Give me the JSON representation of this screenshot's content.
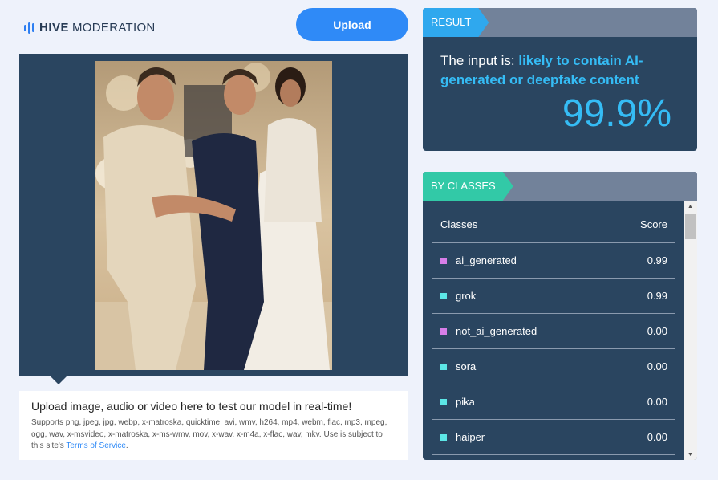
{
  "header": {
    "logo_brand": "HIVE",
    "logo_product": "MODERATION",
    "upload_label": "Upload"
  },
  "upload_panel": {
    "title": "Upload image, audio or video here to test our model in real-time!",
    "description": "Supports png, jpeg, jpg, webp, x-matroska, quicktime, avi, wmv, h264, mp4, webm, flac, mp3, mpeg, ogg, wav, x-msvideo, x-matroska, x-ms-wmv, mov, x-wav, x-m4a, x-flac, wav, mkv. Use is subject to this site's",
    "tos_link": "Terms of Service",
    "tos_suffix": "."
  },
  "result": {
    "tag": "RESULT",
    "prefix": "The input is:",
    "verdict": "likely to contain AI-generated or deepfake content",
    "percent": "99.9%"
  },
  "by_classes": {
    "tag": "BY CLASSES",
    "col_classes": "Classes",
    "col_score": "Score",
    "rows": [
      {
        "name": "ai_generated",
        "score": "0.99",
        "color": "#d77ee8"
      },
      {
        "name": "grok",
        "score": "0.99",
        "color": "#5ce6e6"
      },
      {
        "name": "not_ai_generated",
        "score": "0.00",
        "color": "#d77ee8"
      },
      {
        "name": "sora",
        "score": "0.00",
        "color": "#5ce6e6"
      },
      {
        "name": "pika",
        "score": "0.00",
        "color": "#5ce6e6"
      },
      {
        "name": "haiper",
        "score": "0.00",
        "color": "#5ce6e6"
      }
    ]
  },
  "colors": {
    "accent_blue": "#2f8af7",
    "panel_dark": "#2a4560",
    "highlight_cyan": "#35bcf5",
    "tag_green": "#32c9a7"
  },
  "icons": {
    "logo": "soundwave-bars-icon",
    "scroll_up": "triangle-up-icon",
    "scroll_down": "triangle-down-icon"
  }
}
